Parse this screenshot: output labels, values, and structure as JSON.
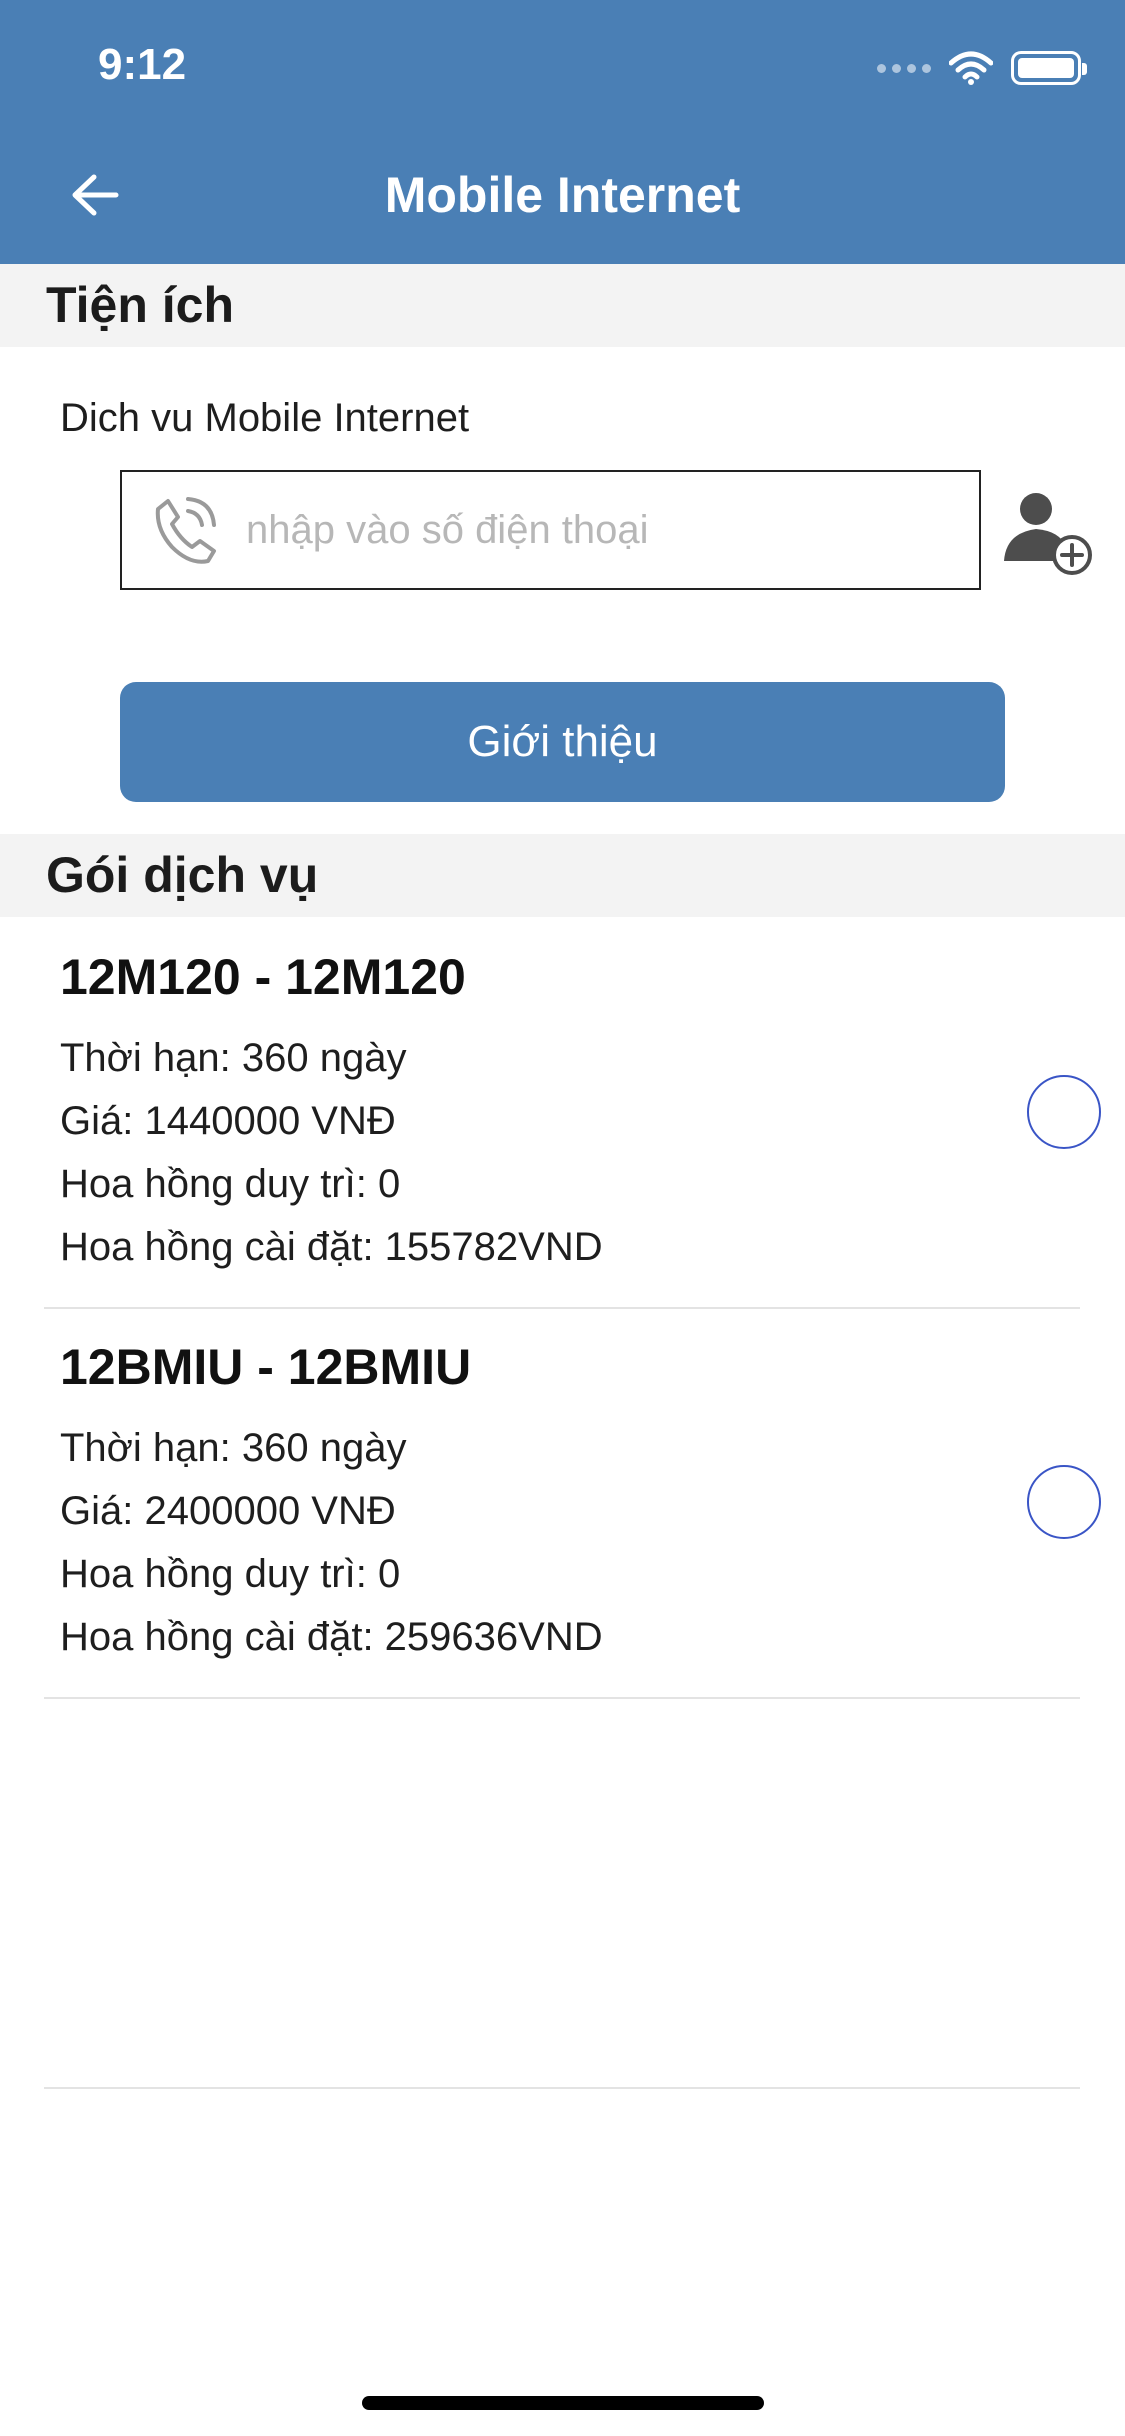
{
  "status_bar": {
    "time": "9:12"
  },
  "nav": {
    "title": "Mobile Internet"
  },
  "utilities": {
    "section_title": "Tiện ích",
    "service_label": "Dich vu Mobile Internet",
    "phone_placeholder": "nhập vào số điện thoại",
    "phone_value": "",
    "intro_button": "Giới thiệu"
  },
  "packages": {
    "section_title": "Gói dịch vụ",
    "items": [
      {
        "title": "12M120 - 12M120",
        "duration": "Thời hạn: 360 ngày",
        "price": "Giá: 1440000 VNĐ",
        "maintain_commission": "Hoa hồng duy trì: 0",
        "install_commission": "Hoa hồng cài đặt: 155782VND",
        "selected": false
      },
      {
        "title": "12BMIU - 12BMIU",
        "duration": "Thời hạn: 360 ngày",
        "price": "Giá: 2400000 VNĐ",
        "maintain_commission": "Hoa hồng duy trì: 0",
        "install_commission": "Hoa hồng cài đặt: 259636VND",
        "selected": false
      }
    ]
  },
  "icons": {
    "back": "arrow-left-icon",
    "phone": "phone-call-icon",
    "add_contact": "add-contact-icon",
    "wifi": "wifi-icon",
    "battery": "battery-icon",
    "signal": "signal-icon"
  },
  "colors": {
    "header": "#4a7fb5",
    "button": "#4a7fb5",
    "radio": "#3a55c6",
    "section_bg": "#f3f3f3"
  }
}
